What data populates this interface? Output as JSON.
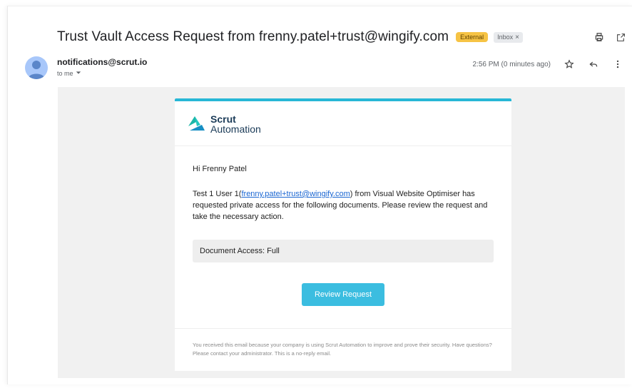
{
  "email": {
    "subject": "Trust Vault Access Request from frenny.patel+trust@wingify.com",
    "labels": {
      "external": "External",
      "inbox": "Inbox",
      "inbox_remove": "×"
    },
    "sender": "notifications@scrut.io",
    "recipient": "to me",
    "time": "2:56 PM (0 minutes ago)"
  },
  "content": {
    "brand_line1": "Scrut",
    "brand_line2": "Automation",
    "greeting": "Hi Frenny Patel",
    "message_prefix": "Test 1 User 1(",
    "message_link": "frenny.patel+trust@wingify.com",
    "message_suffix": ") from Visual Website Optimiser has requested private access for the following documents. Please review the request and take the necessary action.",
    "access": "Document Access: Full",
    "button": "Review Request",
    "footer": "You received this email because your company is using Scrut Automation to improve and prove their security. Have questions? Please contact your administrator. This is a no-reply email."
  },
  "colors": {
    "accent": "#27b7d6",
    "button": "#3bbde0",
    "external_badge": "#f6c344",
    "link": "#1a66d2"
  }
}
